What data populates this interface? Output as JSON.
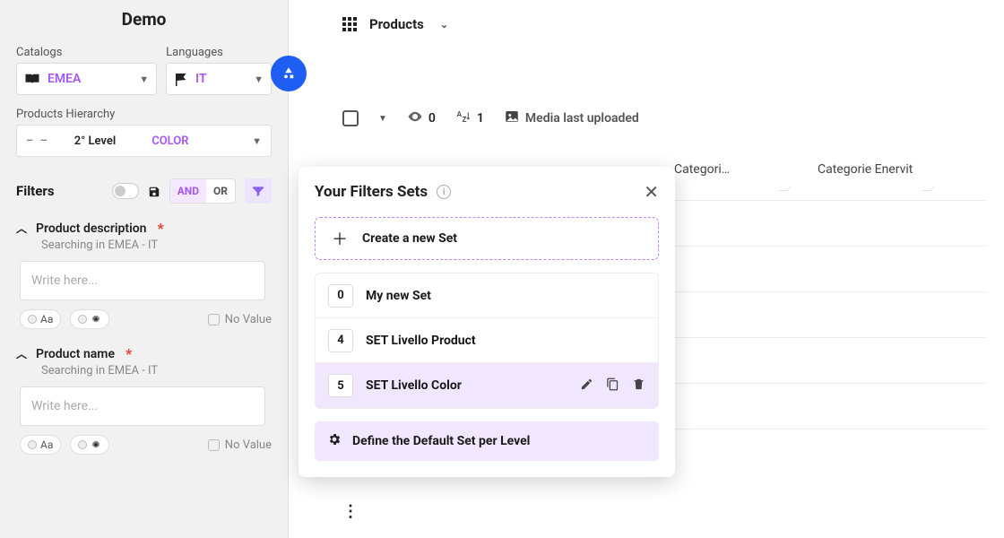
{
  "sidebar": {
    "title": "Demo",
    "catalogs_label": "Catalogs",
    "catalog_value": "EMEA",
    "languages_label": "Languages",
    "language_value": "IT",
    "hierarchy_label": "Products Hierarchy",
    "hierarchy_dash": "– –",
    "hierarchy_level": "2° Level",
    "hierarchy_color": "COLOR",
    "filters_label": "Filters",
    "and_label": "AND",
    "or_label": "OR",
    "blocks": [
      {
        "title": "Product description",
        "sub": "Searching in EMEA - IT",
        "placeholder": "Write here...",
        "aa": "Aa",
        "noval": "No Value"
      },
      {
        "title": "Product name",
        "sub": "Searching in EMEA - IT",
        "placeholder": "Write here...",
        "aa": "Aa",
        "noval": "No Value"
      }
    ]
  },
  "main": {
    "breadcrumb": "Products",
    "toolbar": {
      "view_count": "0",
      "sort_count": "1",
      "media_label": "Media last uploaded"
    },
    "columns": [
      "Categori…",
      "Categorie Enervit"
    ]
  },
  "popover": {
    "title": "Your Filters Sets",
    "create_label": "Create a new Set",
    "items": [
      {
        "count": "0",
        "label": "My new Set"
      },
      {
        "count": "4",
        "label": "SET Livello Product"
      },
      {
        "count": "5",
        "label": "SET Livello Color"
      }
    ],
    "footer": "Define the Default Set per Level"
  }
}
